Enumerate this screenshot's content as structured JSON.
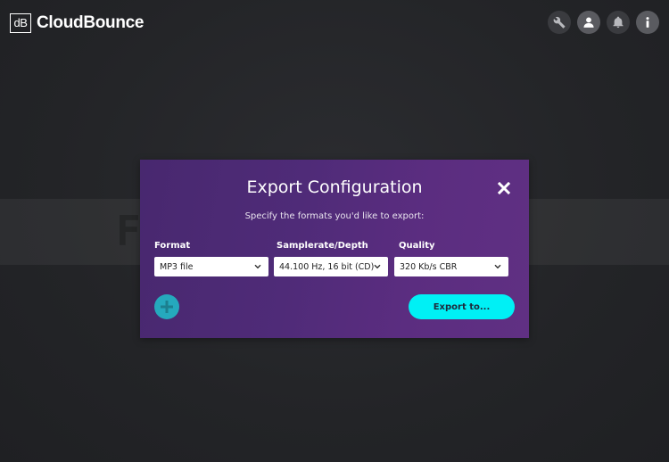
{
  "app": {
    "logo_mark": "dB",
    "name": "CloudBounce"
  },
  "header": {
    "icons": [
      "wrench-icon",
      "user-icon",
      "bell-icon",
      "info-icon"
    ]
  },
  "watermark": {
    "text": "FLYING-DAW.com"
  },
  "dialog": {
    "title": "Export Configuration",
    "subtitle": "Specify the formats you'd like to export:",
    "fields": [
      {
        "label": "Format",
        "value": "MP3 file"
      },
      {
        "label": "Samplerate/Depth",
        "value": "44.100 Hz, 16 bit (CD)"
      },
      {
        "label": "Quality",
        "value": "320 Kb/s CBR"
      }
    ],
    "export_label": "Export to...",
    "colors": {
      "accent": "#00f0f5",
      "add_button": "#25a9bd",
      "dialog_start": "#48286f",
      "dialog_end": "#603083"
    }
  }
}
